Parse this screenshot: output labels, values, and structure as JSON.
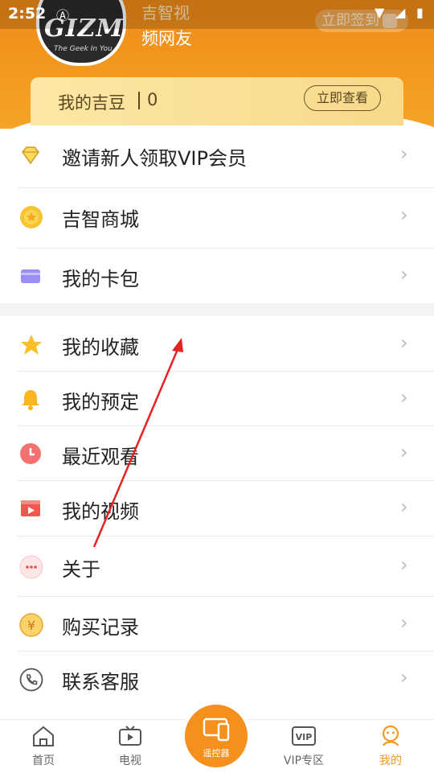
{
  "status": {
    "time": "2:52"
  },
  "profile": {
    "avatar_text": "GIZMEI",
    "avatar_sub": "The Geek In You",
    "name_line1": "吉智视",
    "name_line2": "频网友",
    "checkin_label": "立即签到"
  },
  "beans": {
    "label": "我的吉豆",
    "value": "0",
    "button": "立即查看"
  },
  "menu_group1": [
    {
      "label": "邀请新人领取VIP会员",
      "icon": "diamond-icon"
    },
    {
      "label": "吉智商城",
      "icon": "store-coin-icon"
    },
    {
      "label": "我的卡包",
      "icon": "card-icon"
    }
  ],
  "menu_group2": [
    {
      "label": "我的收藏",
      "icon": "star-icon"
    },
    {
      "label": "我的预定",
      "icon": "bell-icon"
    },
    {
      "label": "最近观看",
      "icon": "clock-icon"
    },
    {
      "label": "我的视频",
      "icon": "video-icon"
    },
    {
      "label": "关于",
      "icon": "more-icon"
    },
    {
      "label": "购买记录",
      "icon": "yuan-icon"
    },
    {
      "label": "联系客服",
      "icon": "phone-icon"
    }
  ],
  "tabs": [
    {
      "label": "首页",
      "icon": "home-icon"
    },
    {
      "label": "电视",
      "icon": "tv-icon"
    },
    {
      "label": "遥控器",
      "icon": "remote-icon"
    },
    {
      "label": "VIP专区",
      "icon": "vip-icon"
    },
    {
      "label": "我的",
      "icon": "profile-icon"
    }
  ],
  "colors": {
    "accent": "#f39a1f",
    "header": "#f08a18"
  }
}
